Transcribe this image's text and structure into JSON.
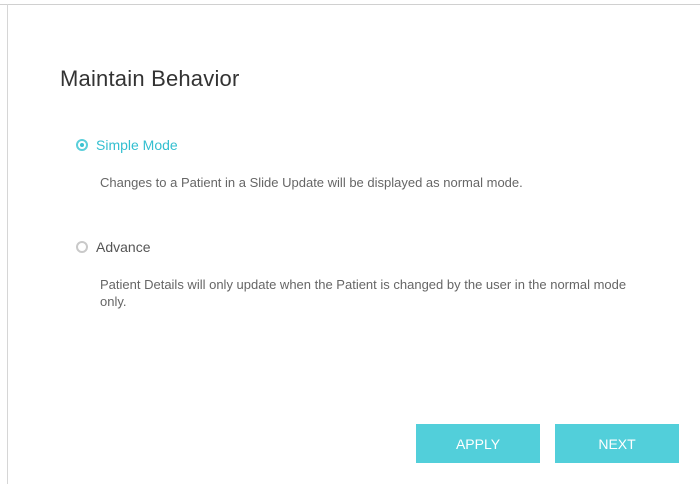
{
  "dialog": {
    "title": "Maintain Behavior"
  },
  "options": [
    {
      "label": "Simple Mode",
      "selected": true,
      "description": "Changes to a Patient in a Slide Update will be displayed as normal mode."
    },
    {
      "label": "Advance",
      "selected": false,
      "description": "Patient Details will only update when the Patient is changed by the user in the normal mode only."
    }
  ],
  "buttons": {
    "apply_label": "APPLY",
    "next_label": "NEXT"
  },
  "colors": {
    "accent": "#52cfda",
    "selected_text": "#33bfd0"
  }
}
